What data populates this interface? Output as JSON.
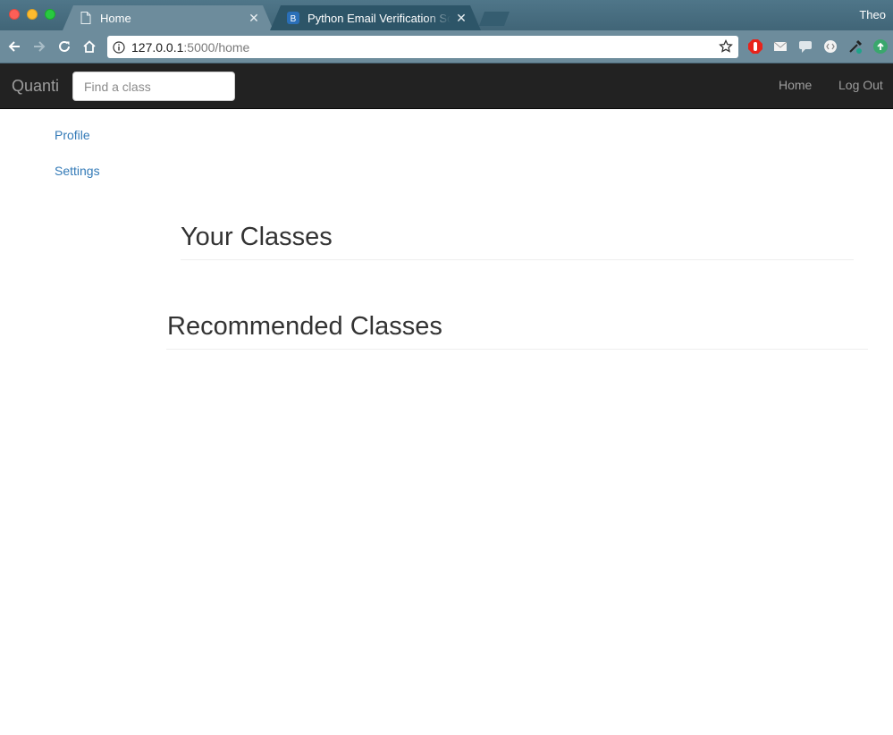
{
  "browser": {
    "tabs": [
      {
        "title": "Home",
        "icon": "page-icon",
        "active": true
      },
      {
        "title": "Python Email Verification Script",
        "icon": "bootstrap-icon",
        "active": false
      }
    ],
    "profile_name": "Theo",
    "url_host": "127.0.0.1",
    "url_path": ":5000/home",
    "extensions": [
      "adblock-icon",
      "mail-icon",
      "chat-icon",
      "code-icon",
      "eyedropper-icon",
      "upload-icon"
    ]
  },
  "navbar": {
    "brand": "Quanti",
    "search_placeholder": "Find a class",
    "links": [
      "Home",
      "Log Out"
    ]
  },
  "sidebar": {
    "items": [
      "Profile",
      "Settings"
    ]
  },
  "main": {
    "your_classes_title": "Your Classes",
    "recommended_title": "Recommended Classes"
  },
  "colors": {
    "link": "#337ab7",
    "navbar_bg": "#222222",
    "navbar_text": "#9d9d9d",
    "chrome_frame": "#6d8c9c"
  }
}
